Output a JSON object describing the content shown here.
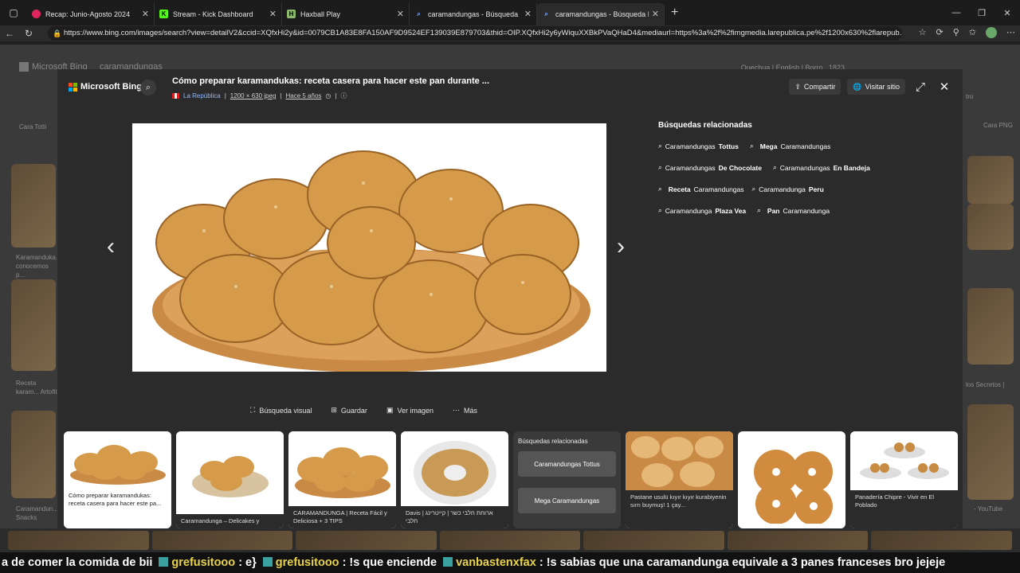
{
  "tabs": [
    {
      "title": "Recap: Junio-Agosto 2024",
      "fav_color": "#e0245e",
      "fav_glyph": "●"
    },
    {
      "title": "Stream - Kick Dashboard",
      "fav_color": "#53fc18",
      "fav_glyph": "K"
    },
    {
      "title": "Haxball Play",
      "fav_color": "#8bb86b",
      "fav_glyph": "H"
    },
    {
      "title": "caramandungas - Búsqueda",
      "fav_color": "#2a6fdb",
      "fav_glyph": "🔍"
    },
    {
      "title": "caramandungas - Búsqueda Imá",
      "fav_color": "#2a6fdb",
      "fav_glyph": "🔍"
    }
  ],
  "address": {
    "url": "https://www.bing.com/images/search?view=detailV2&ccid=XQfxHi2y&id=0079CB1A83E8FA150AF9D9524EF139039E879703&thid=OIP.XQfxHi2y6yWiquXXBkPVaQHaD4&mediaurl=https%3a%2f%2fimgmedia.larepublica.pe%2f1200x630%2flarepub..."
  },
  "background": {
    "brand": "Microsoft Bing",
    "query": "caramandungas",
    "header_links": [
      "Quechua",
      "English",
      "Borro",
      "1823"
    ],
    "snippets": [
      "Karamanduka... conocemos p...",
      "Receta karam... Artofit",
      "Caramandun... Snacks",
      "los Secretos |",
      "- YouTube",
      "Cara PNG",
      "Cara Totti",
      "tro"
    ]
  },
  "modal": {
    "brand": "Microsoft Bing",
    "title": "Cómo preparar karamandukas: receta casera para hacer este pan durante ...",
    "source": "La República",
    "dims": "1200 × 630 jpeg",
    "age": "Hace 5 años",
    "share_label": "Compartir",
    "visit_label": "Visitar sitio",
    "related_title": "Búsquedas relacionadas",
    "related": [
      {
        "pre": "Caramandungas ",
        "bold": "Tottus",
        "post": ""
      },
      {
        "pre": "",
        "bold": "Mega",
        "post": " Caramandungas"
      },
      {
        "pre": "Caramandungas ",
        "bold": "De Chocolate",
        "post": ""
      },
      {
        "pre": "Caramandungas ",
        "bold": "En Bandeja",
        "post": ""
      },
      {
        "pre": "",
        "bold": "Receta",
        "post": " Caramandungas"
      },
      {
        "pre": "Caramandunga ",
        "bold": "Peru",
        "post": ""
      },
      {
        "pre": "Caramandunga ",
        "bold": "Plaza Vea",
        "post": ""
      },
      {
        "pre": "",
        "bold": "Pan",
        "post": " Caramandunga"
      }
    ],
    "tools": [
      "Búsqueda visual",
      "Guardar",
      "Ver imagen",
      "Más"
    ]
  },
  "strip": [
    {
      "caption": "Cómo preparar karamandukas: receta casera para hacer este pa..."
    },
    {
      "caption": "Caramandunga – Delicakes y"
    },
    {
      "caption": "CARAMANDUNGA | Receta Fácil y Deliciosa + 3 TIPS"
    },
    {
      "caption": "Davis | ארוחת חלבי כשר | קייטרינג חלבי"
    },
    {
      "related_title": "Búsquedas relacionadas",
      "rel1": "Caramandungas Tottus",
      "rel2": "Mega Caramandungas"
    },
    {
      "caption": "Pastane usulü kıyır kıyır kurabiyenin sırrı buymuş! 1 çay..."
    },
    {
      "caption": ""
    },
    {
      "caption": "Panadería Chipre - Vivir en El Poblado"
    }
  ],
  "chat": {
    "m0_text": "a de comer la comida de bii",
    "m1_user": "grefusitooo",
    "m1_text": ": e}",
    "m2_user": "grefusitooo",
    "m2_text": ": !s que enciende",
    "m3_user": "vanbastenxfax",
    "m3_text": ": !s sabias que una caramandunga equivale a 3 panes franceses bro jejeje"
  }
}
